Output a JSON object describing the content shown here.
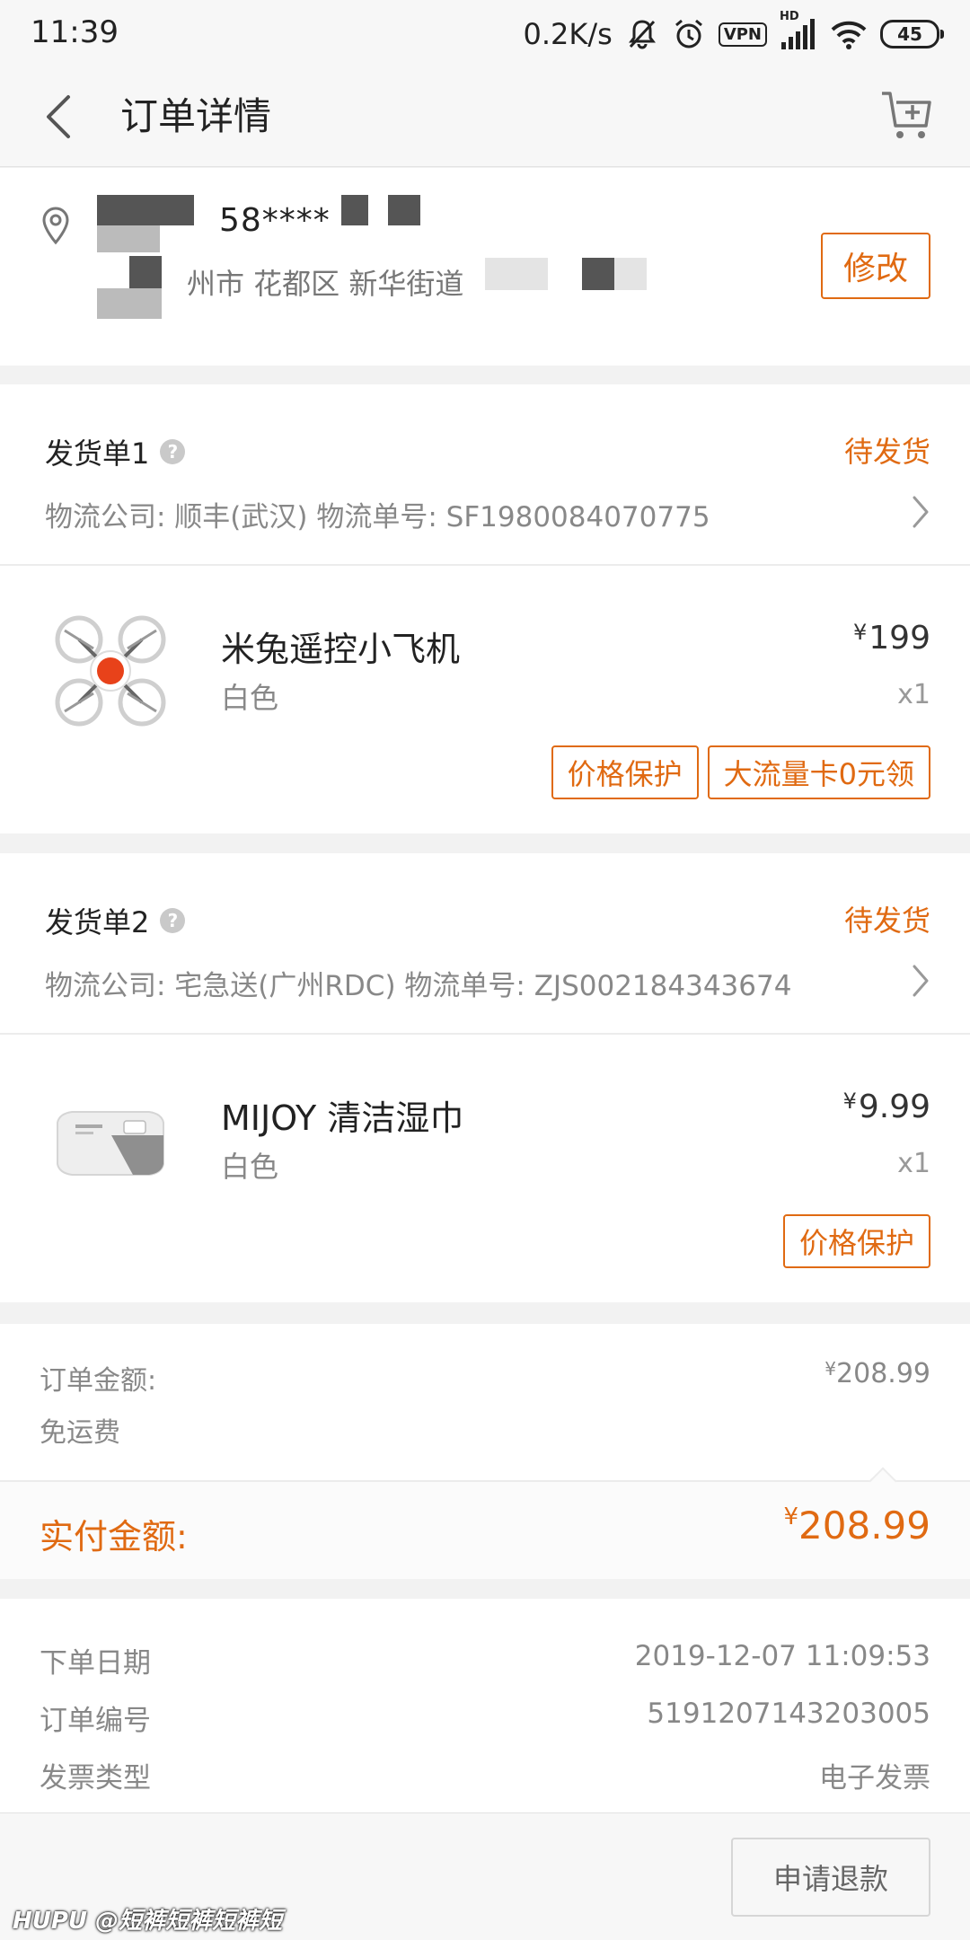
{
  "status_bar": {
    "time": "11:39",
    "net_speed": "0.2K/s",
    "vpn_label": "VPN",
    "hd_label": "HD",
    "battery": "45"
  },
  "header": {
    "title": "订单详情",
    "back_icon": "chevron-left-icon",
    "cart_icon": "cart-add-icon"
  },
  "address": {
    "phone": "58****",
    "address_text": "州市 花都区 新华街道",
    "edit_label": "修改"
  },
  "shipments": [
    {
      "title": "发货单1",
      "status": "待发货",
      "logistics": "物流公司: 顺丰(武汉)   物流单号: SF1980084070775",
      "product": {
        "name": "米兔遥控小飞机",
        "spec": "白色",
        "currency": "¥",
        "price": "199",
        "qty": "x1",
        "image_icon": "drone-image",
        "buttons": [
          "价格保护",
          "大流量卡0元领"
        ]
      }
    },
    {
      "title": "发货单2",
      "status": "待发货",
      "logistics": "物流公司: 宅急送(广州RDC)   物流单号: ZJS002184343674",
      "product": {
        "name": "MIJOY 清洁湿巾",
        "spec": "白色",
        "currency": "¥",
        "price": "9.99",
        "qty": "x1",
        "image_icon": "wipes-pack-image",
        "buttons": [
          "价格保护"
        ]
      }
    }
  ],
  "summary": {
    "order_amount_label": "订单金额:",
    "currency": "¥",
    "order_amount": "208.99",
    "shipping_label": "免运费",
    "paid_label": "实付金额:",
    "paid_amount": "208.99"
  },
  "order_info": [
    {
      "label": "下单日期",
      "value": "2019-12-07 11:09:53"
    },
    {
      "label": "订单编号",
      "value": "5191207143203005"
    },
    {
      "label": "发票类型",
      "value": "电子发票"
    }
  ],
  "footer": {
    "refund_label": "申请退款",
    "watermark": "HUPU @短裤短裤短裤短"
  },
  "colors": {
    "accent": "#e06a12",
    "background": "#f2f2f2"
  }
}
